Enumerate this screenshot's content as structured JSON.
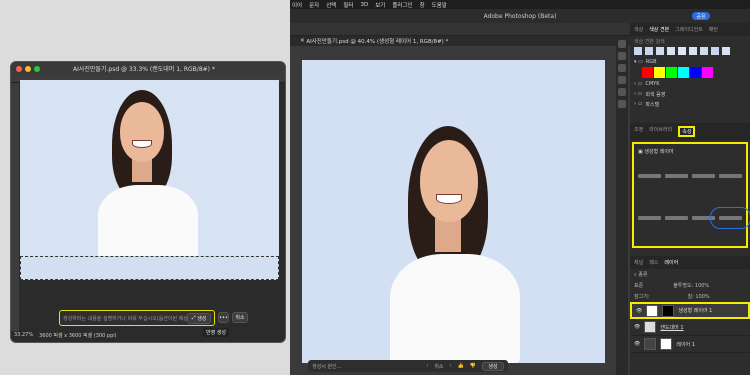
{
  "left_window": {
    "title": "AI사진만들기.psd @ 33.3% (캔도대머 1, RGB/8#) *",
    "status_zoom": "33.27%",
    "status_size": "3600 픽셀 x 3600 픽셀 (300 ppi)",
    "prompt_placeholder": "생성하려는 내용을 설명하거나 비워 두십시오(옵션이된 예상)",
    "generate_label": "생성",
    "more_label": "•••",
    "cancel_label": "취소",
    "tooltip": "반영 생성"
  },
  "right_app": {
    "menu": [
      "이어",
      "문자",
      "선택",
      "필터",
      "3D",
      "보기",
      "플러그인",
      "창",
      "도움말"
    ],
    "app_title": "Adobe Photoshop (Beta)",
    "share_label": "공유",
    "doc_title": "AI사진만들기.psd @ 40.4% (생성형 레이어 1, RGB/8#) *",
    "context_prompt": "생성시 원인...",
    "context_cancel": "취소",
    "context_generate": "생성",
    "panel_tabs_top": [
      "색상",
      "색상 견본",
      "그레이디언트",
      "패턴"
    ],
    "swatch_search": "색상 견본 검색",
    "swatch_groups": [
      "RGB",
      "CMYK",
      "회색 음영",
      "파스텔"
    ],
    "panel_tabs_mid": [
      "조정",
      "라이브러리",
      "속성"
    ],
    "properties_title": "생성형 레이어",
    "panel_tabs_bottom": [
      "채널",
      "패스",
      "레이어"
    ],
    "layer_filter": "종류",
    "blend_mode": "표준",
    "opacity_label": "불투명도:",
    "opacity_value": "100%",
    "lock_label": "잠그기:",
    "fill_label": "칠:",
    "fill_value": "100%",
    "layers": [
      "생성형 레이어 1",
      "캔도대머 1",
      "레이어 1"
    ]
  },
  "colors": {
    "highlight": "#f3ee00",
    "share": "#2b6fe0",
    "swatches": [
      "#ff0000",
      "#ffff00",
      "#00ff00",
      "#00ffff",
      "#0000ff",
      "#ff00ff"
    ]
  }
}
